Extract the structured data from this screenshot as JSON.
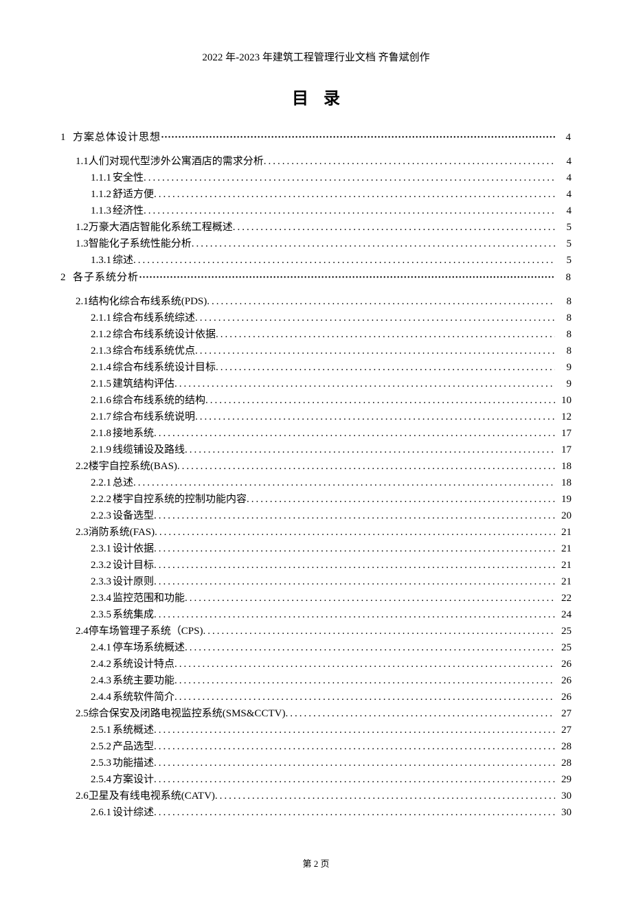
{
  "header": "2022 年-2023 年建筑工程管理行业文档  齐鲁斌创作",
  "title": "目录",
  "toc": [
    {
      "lvl": 1,
      "num": "1",
      "text": "方案总体设计思想",
      "page": "4"
    },
    {
      "lvl": 2,
      "num": "1.1",
      "text": "人们对现代型涉外公寓酒店的需求分析",
      "page": "4"
    },
    {
      "lvl": 3,
      "num": "1.1.1",
      "text": "安全性",
      "page": "4"
    },
    {
      "lvl": 3,
      "num": "1.1.2",
      "text": "舒适方便",
      "page": "4"
    },
    {
      "lvl": 3,
      "num": "1.1.3",
      "text": "经济性",
      "page": "4"
    },
    {
      "lvl": 2,
      "num": "1.2",
      "text": "万豪大酒店智能化系统工程概述",
      "page": "5"
    },
    {
      "lvl": 2,
      "num": "1.3",
      "text": "智能化子系统性能分析",
      "page": "5"
    },
    {
      "lvl": 3,
      "num": "1.3.1",
      "text": "综述",
      "page": "5"
    },
    {
      "lvl": 1,
      "num": "2",
      "text": "各子系统分析",
      "page": "8"
    },
    {
      "lvl": 2,
      "num": "2.1",
      "text": "结构化综合布线系统(PDS)",
      "page": "8"
    },
    {
      "lvl": 3,
      "num": "2.1.1",
      "text": "综合布线系统综述",
      "page": "8"
    },
    {
      "lvl": 3,
      "num": "2.1.2",
      "text": "综合布线系统设计依据",
      "page": "8"
    },
    {
      "lvl": 3,
      "num": "2.1.3",
      "text": "综合布线系统优点",
      "page": "8"
    },
    {
      "lvl": 3,
      "num": "2.1.4",
      "text": "综合布线系统设计目标",
      "page": "9"
    },
    {
      "lvl": 3,
      "num": "2.1.5",
      "text": "建筑结构评估",
      "page": "9"
    },
    {
      "lvl": 3,
      "num": "2.1.6",
      "text": "综合布线系统的结构",
      "page": "10"
    },
    {
      "lvl": 3,
      "num": "2.1.7",
      "text": "综合布线系统说明",
      "page": "12"
    },
    {
      "lvl": 3,
      "num": "2.1.8",
      "text": "接地系统",
      "page": "17"
    },
    {
      "lvl": 3,
      "num": "2.1.9",
      "text": "线缆铺设及路线",
      "page": "17"
    },
    {
      "lvl": 2,
      "num": "2.2",
      "text": "楼宇自控系统(BAS)",
      "page": "18"
    },
    {
      "lvl": 3,
      "num": "2.2.1",
      "text": "总述",
      "page": "18"
    },
    {
      "lvl": 3,
      "num": "2.2.2",
      "text": "楼宇自控系统的控制功能内容",
      "page": "19"
    },
    {
      "lvl": 3,
      "num": "2.2.3",
      "text": "设备选型",
      "page": "20"
    },
    {
      "lvl": 2,
      "num": "2.3",
      "text": "消防系统(FAS)",
      "page": "21"
    },
    {
      "lvl": 3,
      "num": "2.3.1",
      "text": "设计依据",
      "page": "21"
    },
    {
      "lvl": 3,
      "num": "2.3.2",
      "text": "设计目标",
      "page": "21"
    },
    {
      "lvl": 3,
      "num": "2.3.3",
      "text": "设计原则",
      "page": "21"
    },
    {
      "lvl": 3,
      "num": "2.3.4",
      "text": "监控范围和功能",
      "page": "22"
    },
    {
      "lvl": 3,
      "num": "2.3.5",
      "text": "系统集成",
      "page": "24"
    },
    {
      "lvl": 2,
      "num": "2.4",
      "text": "停车场管理子系统（CPS)",
      "page": "25"
    },
    {
      "lvl": 3,
      "num": "2.4.1",
      "text": "停车场系统概述",
      "page": "25"
    },
    {
      "lvl": 3,
      "num": "2.4.2",
      "text": "系统设计特点",
      "page": "26"
    },
    {
      "lvl": 3,
      "num": "2.4.3",
      "text": "系统主要功能",
      "page": "26"
    },
    {
      "lvl": 3,
      "num": "2.4.4",
      "text": "系统软件简介",
      "page": "26"
    },
    {
      "lvl": 2,
      "num": "2.5",
      "text": "综合保安及闭路电视监控系统(SMS&CCTV)",
      "page": "27"
    },
    {
      "lvl": 3,
      "num": "2.5.1",
      "text": "系统概述",
      "page": "27"
    },
    {
      "lvl": 3,
      "num": "2.5.2",
      "text": "产品选型",
      "page": "28"
    },
    {
      "lvl": 3,
      "num": "2.5.3",
      "text": "功能描述",
      "page": "28"
    },
    {
      "lvl": 3,
      "num": "2.5.4",
      "text": "方案设计",
      "page": "29"
    },
    {
      "lvl": 2,
      "num": "2.6",
      "text": "卫星及有线电视系统(CATV)",
      "page": "30"
    },
    {
      "lvl": 3,
      "num": "2.6.1",
      "text": "设计综述",
      "page": "30"
    }
  ],
  "footer": "第 2 页"
}
